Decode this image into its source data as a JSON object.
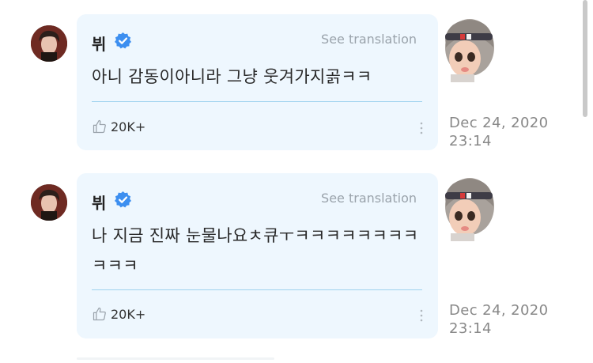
{
  "posts": [
    {
      "author": "뷔",
      "verified_icon": "verified-badge-icon",
      "translate_label": "See translation",
      "message": "아니 감동이아니라 그냥 웃겨가지곩ㅋㅋ",
      "likes": "20K+",
      "date_line1": "Dec 24, 2020",
      "date_line2": "23:14"
    },
    {
      "author": "뷔",
      "verified_icon": "verified-badge-icon",
      "translate_label": "See translation",
      "message": "나 지금 진짜 눈물나요ㅊ큐ㅜㅋㅋㅋㅋㅋㅋㅋㅋㅋㅋㅋ",
      "likes": "20K+",
      "date_line1": "Dec 24, 2020",
      "date_line2": "23:14"
    }
  ],
  "colors": {
    "card_bg": "#eef7fe",
    "verified": "#3d8ff0",
    "divider": "#9ed2ee",
    "muted_text": "#9aa3ab"
  }
}
